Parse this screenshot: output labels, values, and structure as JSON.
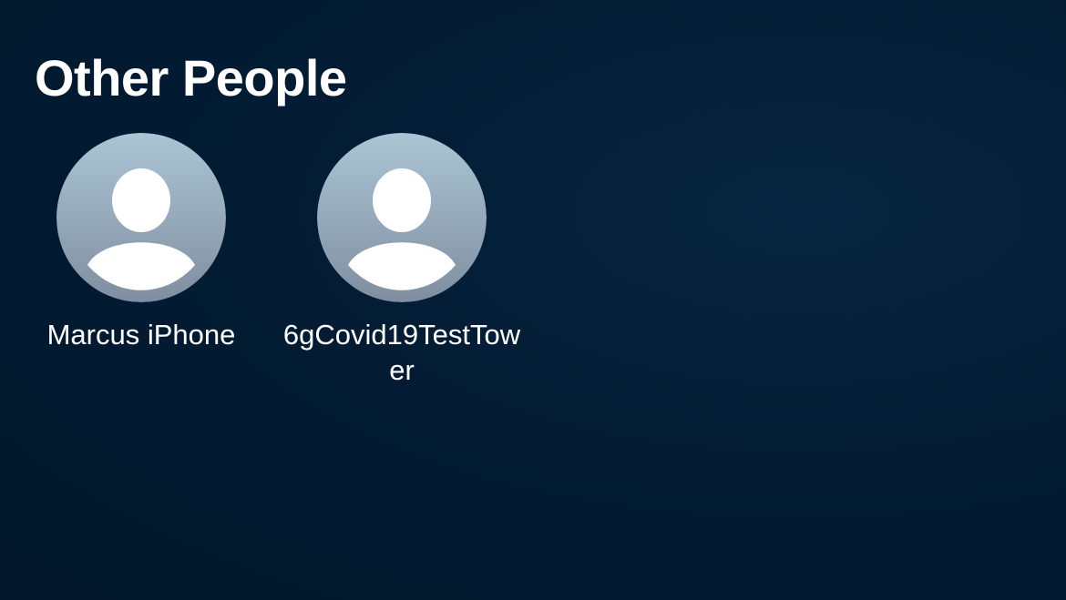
{
  "section": {
    "title": "Other People"
  },
  "people": [
    {
      "name": "Marcus iPhone",
      "icon": "person-placeholder-icon"
    },
    {
      "name": "6gCovid19TestTower",
      "icon": "person-placeholder-icon"
    }
  ],
  "colors": {
    "background": "#021d36",
    "avatar_gradient_top": "#abc5d4",
    "avatar_gradient_bottom": "#7f8ea0",
    "text": "#ffffff"
  }
}
